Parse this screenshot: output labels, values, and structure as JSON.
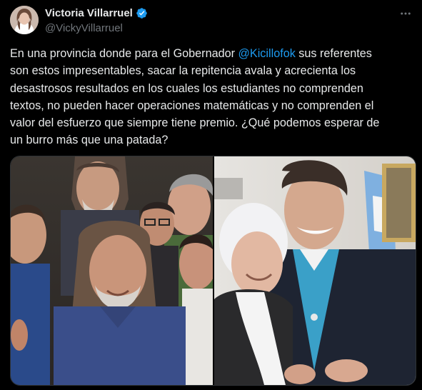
{
  "author": {
    "display_name": "Victoria Villarruel",
    "handle": "@VickyVillarruel",
    "verified": true,
    "avatar_icon": "profile-photo"
  },
  "menu": {
    "more_icon": "more-horizontal-icon"
  },
  "tweet": {
    "text_before_mention": "En una provincia donde para el Gobernador ",
    "mention": "@Kicillofok",
    "text_after_mention": " sus referentes\nson estos impresentables, sacar la repitencia avala y acrecienta los\ndesastrosos resultados en los cuales los estudiantes no comprenden\ntextos, no pueden hacer operaciones matemáticas y no comprenden el\nvalor del esfuerzo que siempre tiene premio. ¿Qué podemos esperar de\nun burro más que una patada?"
  },
  "media": {
    "count": 2,
    "left_photo": "group-of-men-outdoors",
    "right_photo": "woman-hugging-man-indoors"
  },
  "colors": {
    "background": "#000000",
    "text": "#e7e9ea",
    "secondary": "#71767b",
    "link": "#1d9bf0",
    "verified_badge": "#1d9bf0"
  }
}
